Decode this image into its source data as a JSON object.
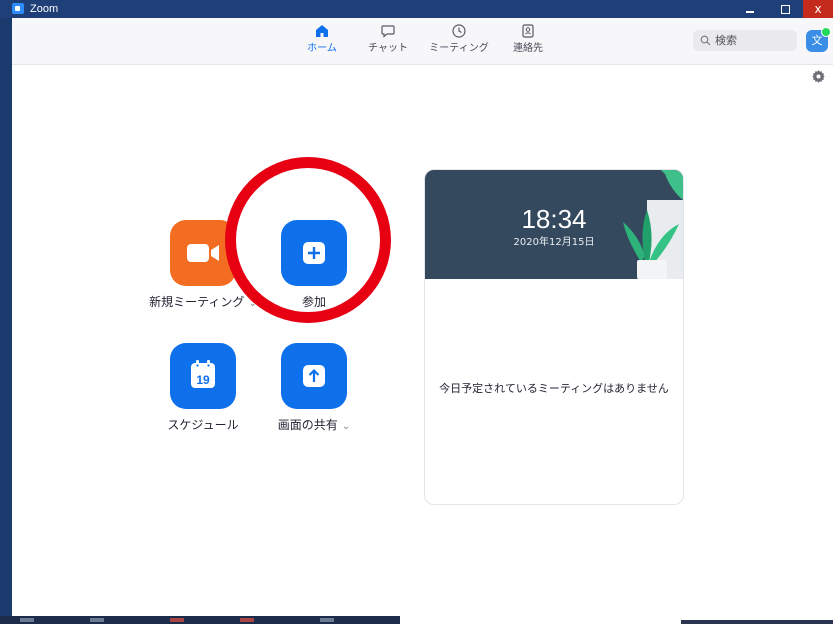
{
  "window": {
    "title": "Zoom",
    "controls": {
      "minimize": "−",
      "maximize": "□",
      "close": "x"
    }
  },
  "nav": {
    "tabs": [
      {
        "label": "ホーム",
        "icon": "home-icon",
        "active": true
      },
      {
        "label": "チャット",
        "icon": "chat-bubble-icon",
        "active": false
      },
      {
        "label": "ミーティング",
        "icon": "clock-icon",
        "active": false
      },
      {
        "label": "連絡先",
        "icon": "contact-card-icon",
        "active": false
      }
    ],
    "search_placeholder": "検索",
    "avatar_text": "文"
  },
  "actions": {
    "new_meeting": {
      "label": "新規ミーティング",
      "chevron": "⌄"
    },
    "join": {
      "label": "参加"
    },
    "schedule": {
      "label": "スケジュール",
      "calendar_day": "19"
    },
    "share_screen": {
      "label": "画面の共有",
      "chevron": "⌄"
    }
  },
  "panel": {
    "time": "18:34",
    "date": "2020年12月15日",
    "empty_message": "今日予定されているミーティングはありません"
  },
  "colors": {
    "accent_blue": "#0e71eb",
    "orange": "#f26d21",
    "annotation_red": "#e60012",
    "hero_bg": "#34495e"
  }
}
